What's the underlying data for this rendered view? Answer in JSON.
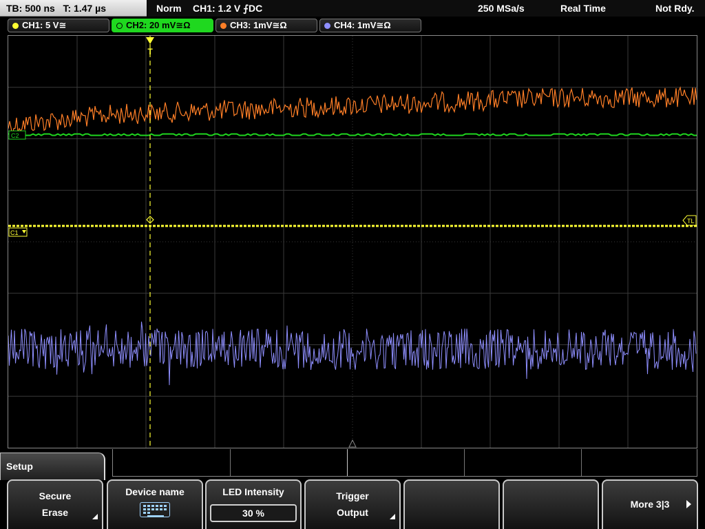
{
  "status": {
    "timebase": "TB: 500 ns",
    "trigger_time": "T: 1.47 µs",
    "mode": "Norm",
    "trigger_info": "CH1: 1.2 V ⨍DC",
    "sample_rate": "250 MSa/s",
    "acq_mode": "Real Time",
    "state": "Not Rdy."
  },
  "channels": [
    {
      "id": "ch1",
      "label": "CH1: 5 V≅",
      "color": "#ffff33",
      "active": false
    },
    {
      "id": "ch2",
      "label": "CH2: 20 mV≅Ω",
      "color": "#1fd81f",
      "active": true
    },
    {
      "id": "ch3",
      "label": "CH3: 1mV≅Ω",
      "color": "#ff7f27",
      "active": false
    },
    {
      "id": "ch4",
      "label": "CH4: 1mV≅Ω",
      "color": "#8f8fff",
      "active": false
    }
  ],
  "markers": {
    "trigger_top": "T",
    "ch1_marker": "C1",
    "ch2_marker": "C2",
    "trigger_level": "TL"
  },
  "softkeys": {
    "setup_label": "Setup",
    "secure_erase_1": "Secure",
    "secure_erase_2": "Erase",
    "device_name": "Device name",
    "led_intensity": "LED Intensity",
    "led_value": "30 %",
    "trigger_output_1": "Trigger",
    "trigger_output_2": "Output",
    "more": "More 3|3"
  },
  "colors": {
    "ch1": "#ffff33",
    "ch2": "#1fd81f",
    "ch3": "#ff7f27",
    "ch4": "#8f8fff",
    "grid": "#3a3a3a"
  },
  "icons": {
    "keyboard": "keyboard-icon",
    "more_arrow": "arrow-right-icon"
  }
}
